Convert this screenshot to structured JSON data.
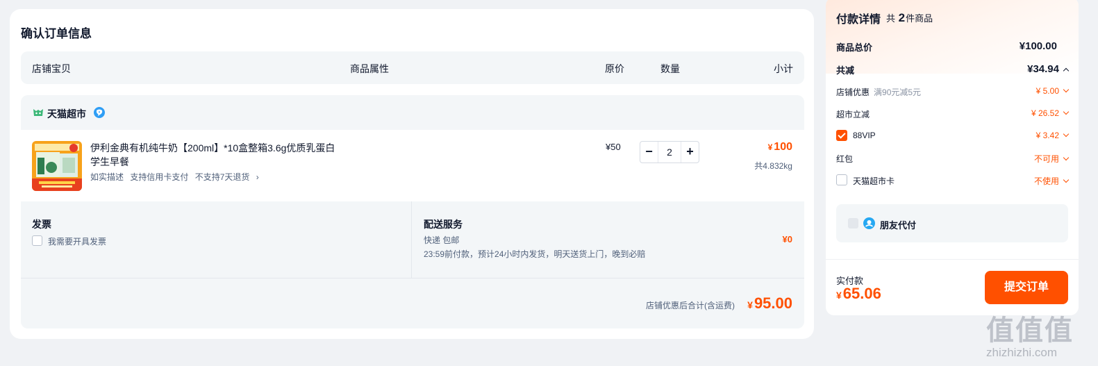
{
  "order": {
    "title": "确认订单信息",
    "columns": {
      "shop": "店铺宝贝",
      "attributes": "商品属性",
      "price": "原价",
      "quantity": "数量",
      "subtotal": "小计"
    },
    "shop_name": "天猫超市",
    "item": {
      "title": "伊利金典有机纯牛奶【200ml】*10盒整箱3.6g优质乳蛋白学生早餐",
      "tags": [
        "如实描述",
        "支持信用卡支付",
        "不支持7天退货",
        "›"
      ],
      "price": "¥50",
      "quantity": "2",
      "minus": "−",
      "plus": "+",
      "subtotal_currency": "¥",
      "subtotal": "100",
      "weight": "共4.832kg"
    },
    "invoice": {
      "title": "发票",
      "option": "我需要开具发票"
    },
    "delivery": {
      "title": "配送服务",
      "method": "快递 包邮",
      "note": "23:59前付款，预计24小时内发货，明天送货上门，晚到必赔",
      "fee": "¥0"
    },
    "total": {
      "label": "店铺优惠后合计(含运费)",
      "currency": "¥",
      "value": "95.00"
    }
  },
  "payment": {
    "title": "付款详情",
    "count_prefix": "共",
    "count": "2",
    "count_suffix": "件商品",
    "goods_total_label": "商品总价",
    "goods_total_value": "¥100.00",
    "discount_label": "共减",
    "discount_value": "¥34.94",
    "rows": [
      {
        "label": "店铺优惠",
        "sub": "满90元减5元",
        "value": "¥ 5.00"
      },
      {
        "label": "超市立减",
        "sub": "",
        "value": "¥ 26.52"
      },
      {
        "label": "88VIP",
        "sub": "",
        "value": "¥ 3.42"
      },
      {
        "label": "红包",
        "sub": "",
        "value": "不可用"
      },
      {
        "label": "天猫超市卡",
        "sub": "",
        "value": "不使用"
      }
    ],
    "friend_pay": "朋友代付",
    "actual_label": "实付款",
    "actual_currency": "¥",
    "actual_value": "65.06",
    "submit": "提交订单"
  },
  "watermark": {
    "logo": "值值值",
    "text": "zhizhizhi.com"
  },
  "colors": {
    "accent": "#ff5000",
    "panel": "#f3f6f8",
    "background": "#f0f2f5"
  }
}
